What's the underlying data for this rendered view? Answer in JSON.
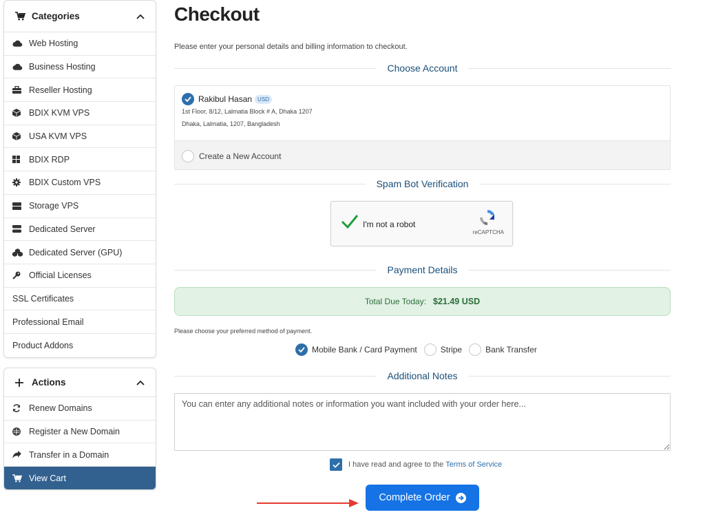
{
  "sidebar": {
    "categories": {
      "title": "Categories",
      "items": [
        {
          "label": "Web Hosting",
          "icon": "cloud-icon"
        },
        {
          "label": "Business Hosting",
          "icon": "cloud-icon"
        },
        {
          "label": "Reseller Hosting",
          "icon": "briefcase-icon"
        },
        {
          "label": "BDIX KVM VPS",
          "icon": "cube-icon"
        },
        {
          "label": "USA KVM VPS",
          "icon": "cube-icon"
        },
        {
          "label": "BDIX RDP",
          "icon": "windows-icon"
        },
        {
          "label": "BDIX Custom VPS",
          "icon": "gear-icon"
        },
        {
          "label": "Storage VPS",
          "icon": "server-icon"
        },
        {
          "label": "Dedicated Server",
          "icon": "hdd-icon"
        },
        {
          "label": "Dedicated Server (GPU)",
          "icon": "cubes-icon"
        },
        {
          "label": "Official Licenses",
          "icon": "key-icon"
        },
        {
          "label": "SSL Certificates",
          "icon": ""
        },
        {
          "label": "Professional Email",
          "icon": ""
        },
        {
          "label": "Product Addons",
          "icon": ""
        }
      ]
    },
    "actions": {
      "title": "Actions",
      "items": [
        {
          "label": "Renew Domains",
          "icon": "sync-icon"
        },
        {
          "label": "Register a New Domain",
          "icon": "globe-icon"
        },
        {
          "label": "Transfer in a Domain",
          "icon": "share-icon"
        },
        {
          "label": "View Cart",
          "icon": "cart-icon",
          "active": true
        }
      ]
    }
  },
  "main": {
    "title": "Checkout",
    "intro": "Please enter your personal details and billing information to checkout.",
    "sections": {
      "account": "Choose Account",
      "spam": "Spam Bot Verification",
      "payment": "Payment Details",
      "notes": "Additional Notes"
    },
    "account": {
      "name": "Rakibul Hasan",
      "currency": "USD",
      "address1": "1st Floor, 8/12, Lalmatia Block # A, Dhaka 1207",
      "address2": "Dhaka, Lalmatia, 1207, Bangladesh",
      "new_account": "Create a New Account"
    },
    "captcha": {
      "label": "I'm not a robot",
      "brand": "reCAPTCHA"
    },
    "payment": {
      "due_label": "Total Due Today:",
      "due_amount": "$21.49 USD",
      "method_note": "Please choose your preferred method of payment.",
      "methods": [
        {
          "label": "Mobile Bank / Card Payment",
          "selected": true
        },
        {
          "label": "Stripe",
          "selected": false
        },
        {
          "label": "Bank Transfer",
          "selected": false
        }
      ]
    },
    "notes_placeholder": "You can enter any additional notes or information you want included with your order here...",
    "tos": {
      "text": "I have read and agree to the",
      "link": "Terms of Service"
    },
    "complete_button": "Complete Order"
  },
  "colors": {
    "accent": "#1573e6",
    "active_sidebar": "#33618f",
    "section_heading": "#1a4f7a",
    "success_bg": "#e2f2e4",
    "arrow": "#e53a2f"
  }
}
